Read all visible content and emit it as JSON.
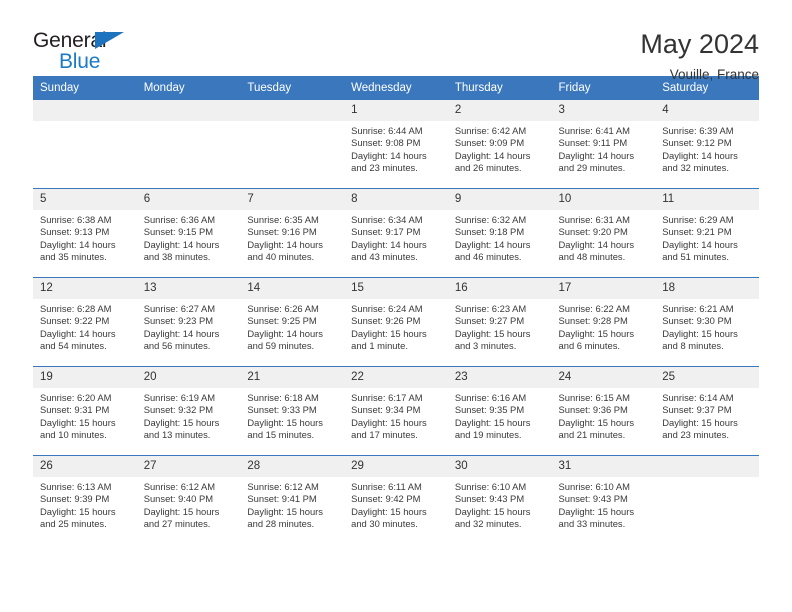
{
  "brand": {
    "line1": "General",
    "line2": "Blue",
    "triangle_color": "#1e73be",
    "text_color": "#231f20"
  },
  "header": {
    "title": "May 2024",
    "subtitle": "Vouille, France"
  },
  "theme": {
    "header_blue": "#3a77bd",
    "daynum_band": "#f0f0f0",
    "text": "#333333"
  },
  "columns": [
    "Sunday",
    "Monday",
    "Tuesday",
    "Wednesday",
    "Thursday",
    "Friday",
    "Saturday"
  ],
  "labels": {
    "sunrise_prefix": "Sunrise:",
    "sunset_prefix": "Sunset:",
    "daylight_prefix": "Daylight:"
  },
  "weeks": [
    [
      {
        "day": "",
        "empty": true
      },
      {
        "day": "",
        "empty": true
      },
      {
        "day": "",
        "empty": true
      },
      {
        "day": "1",
        "sunrise": "Sunrise: 6:44 AM",
        "sunset": "Sunset: 9:08 PM",
        "daylight_a": "Daylight: 14 hours",
        "daylight_b": "and 23 minutes."
      },
      {
        "day": "2",
        "sunrise": "Sunrise: 6:42 AM",
        "sunset": "Sunset: 9:09 PM",
        "daylight_a": "Daylight: 14 hours",
        "daylight_b": "and 26 minutes."
      },
      {
        "day": "3",
        "sunrise": "Sunrise: 6:41 AM",
        "sunset": "Sunset: 9:11 PM",
        "daylight_a": "Daylight: 14 hours",
        "daylight_b": "and 29 minutes."
      },
      {
        "day": "4",
        "sunrise": "Sunrise: 6:39 AM",
        "sunset": "Sunset: 9:12 PM",
        "daylight_a": "Daylight: 14 hours",
        "daylight_b": "and 32 minutes."
      }
    ],
    [
      {
        "day": "5",
        "sunrise": "Sunrise: 6:38 AM",
        "sunset": "Sunset: 9:13 PM",
        "daylight_a": "Daylight: 14 hours",
        "daylight_b": "and 35 minutes."
      },
      {
        "day": "6",
        "sunrise": "Sunrise: 6:36 AM",
        "sunset": "Sunset: 9:15 PM",
        "daylight_a": "Daylight: 14 hours",
        "daylight_b": "and 38 minutes."
      },
      {
        "day": "7",
        "sunrise": "Sunrise: 6:35 AM",
        "sunset": "Sunset: 9:16 PM",
        "daylight_a": "Daylight: 14 hours",
        "daylight_b": "and 40 minutes."
      },
      {
        "day": "8",
        "sunrise": "Sunrise: 6:34 AM",
        "sunset": "Sunset: 9:17 PM",
        "daylight_a": "Daylight: 14 hours",
        "daylight_b": "and 43 minutes."
      },
      {
        "day": "9",
        "sunrise": "Sunrise: 6:32 AM",
        "sunset": "Sunset: 9:18 PM",
        "daylight_a": "Daylight: 14 hours",
        "daylight_b": "and 46 minutes."
      },
      {
        "day": "10",
        "sunrise": "Sunrise: 6:31 AM",
        "sunset": "Sunset: 9:20 PM",
        "daylight_a": "Daylight: 14 hours",
        "daylight_b": "and 48 minutes."
      },
      {
        "day": "11",
        "sunrise": "Sunrise: 6:29 AM",
        "sunset": "Sunset: 9:21 PM",
        "daylight_a": "Daylight: 14 hours",
        "daylight_b": "and 51 minutes."
      }
    ],
    [
      {
        "day": "12",
        "sunrise": "Sunrise: 6:28 AM",
        "sunset": "Sunset: 9:22 PM",
        "daylight_a": "Daylight: 14 hours",
        "daylight_b": "and 54 minutes."
      },
      {
        "day": "13",
        "sunrise": "Sunrise: 6:27 AM",
        "sunset": "Sunset: 9:23 PM",
        "daylight_a": "Daylight: 14 hours",
        "daylight_b": "and 56 minutes."
      },
      {
        "day": "14",
        "sunrise": "Sunrise: 6:26 AM",
        "sunset": "Sunset: 9:25 PM",
        "daylight_a": "Daylight: 14 hours",
        "daylight_b": "and 59 minutes."
      },
      {
        "day": "15",
        "sunrise": "Sunrise: 6:24 AM",
        "sunset": "Sunset: 9:26 PM",
        "daylight_a": "Daylight: 15 hours",
        "daylight_b": "and 1 minute."
      },
      {
        "day": "16",
        "sunrise": "Sunrise: 6:23 AM",
        "sunset": "Sunset: 9:27 PM",
        "daylight_a": "Daylight: 15 hours",
        "daylight_b": "and 3 minutes."
      },
      {
        "day": "17",
        "sunrise": "Sunrise: 6:22 AM",
        "sunset": "Sunset: 9:28 PM",
        "daylight_a": "Daylight: 15 hours",
        "daylight_b": "and 6 minutes."
      },
      {
        "day": "18",
        "sunrise": "Sunrise: 6:21 AM",
        "sunset": "Sunset: 9:30 PM",
        "daylight_a": "Daylight: 15 hours",
        "daylight_b": "and 8 minutes."
      }
    ],
    [
      {
        "day": "19",
        "sunrise": "Sunrise: 6:20 AM",
        "sunset": "Sunset: 9:31 PM",
        "daylight_a": "Daylight: 15 hours",
        "daylight_b": "and 10 minutes."
      },
      {
        "day": "20",
        "sunrise": "Sunrise: 6:19 AM",
        "sunset": "Sunset: 9:32 PM",
        "daylight_a": "Daylight: 15 hours",
        "daylight_b": "and 13 minutes."
      },
      {
        "day": "21",
        "sunrise": "Sunrise: 6:18 AM",
        "sunset": "Sunset: 9:33 PM",
        "daylight_a": "Daylight: 15 hours",
        "daylight_b": "and 15 minutes."
      },
      {
        "day": "22",
        "sunrise": "Sunrise: 6:17 AM",
        "sunset": "Sunset: 9:34 PM",
        "daylight_a": "Daylight: 15 hours",
        "daylight_b": "and 17 minutes."
      },
      {
        "day": "23",
        "sunrise": "Sunrise: 6:16 AM",
        "sunset": "Sunset: 9:35 PM",
        "daylight_a": "Daylight: 15 hours",
        "daylight_b": "and 19 minutes."
      },
      {
        "day": "24",
        "sunrise": "Sunrise: 6:15 AM",
        "sunset": "Sunset: 9:36 PM",
        "daylight_a": "Daylight: 15 hours",
        "daylight_b": "and 21 minutes."
      },
      {
        "day": "25",
        "sunrise": "Sunrise: 6:14 AM",
        "sunset": "Sunset: 9:37 PM",
        "daylight_a": "Daylight: 15 hours",
        "daylight_b": "and 23 minutes."
      }
    ],
    [
      {
        "day": "26",
        "sunrise": "Sunrise: 6:13 AM",
        "sunset": "Sunset: 9:39 PM",
        "daylight_a": "Daylight: 15 hours",
        "daylight_b": "and 25 minutes."
      },
      {
        "day": "27",
        "sunrise": "Sunrise: 6:12 AM",
        "sunset": "Sunset: 9:40 PM",
        "daylight_a": "Daylight: 15 hours",
        "daylight_b": "and 27 minutes."
      },
      {
        "day": "28",
        "sunrise": "Sunrise: 6:12 AM",
        "sunset": "Sunset: 9:41 PM",
        "daylight_a": "Daylight: 15 hours",
        "daylight_b": "and 28 minutes."
      },
      {
        "day": "29",
        "sunrise": "Sunrise: 6:11 AM",
        "sunset": "Sunset: 9:42 PM",
        "daylight_a": "Daylight: 15 hours",
        "daylight_b": "and 30 minutes."
      },
      {
        "day": "30",
        "sunrise": "Sunrise: 6:10 AM",
        "sunset": "Sunset: 9:43 PM",
        "daylight_a": "Daylight: 15 hours",
        "daylight_b": "and 32 minutes."
      },
      {
        "day": "31",
        "sunrise": "Sunrise: 6:10 AM",
        "sunset": "Sunset: 9:43 PM",
        "daylight_a": "Daylight: 15 hours",
        "daylight_b": "and 33 minutes."
      },
      {
        "day": "",
        "empty": true
      }
    ]
  ]
}
